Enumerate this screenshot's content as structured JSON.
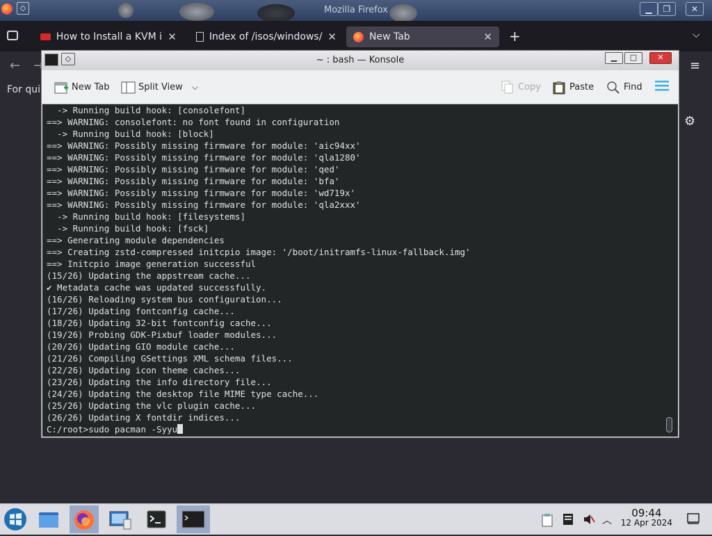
{
  "firefox": {
    "window_title": "Mozilla Firefox",
    "tabs": [
      {
        "label": "How to Install a KVM in A",
        "active": false
      },
      {
        "label": "Index of /isos/windows/",
        "active": false
      },
      {
        "label": "New Tab",
        "active": true
      }
    ],
    "quick_text": "For qui"
  },
  "konsole": {
    "title": "~ : bash — Konsole",
    "toolbar": {
      "new_tab": "New Tab",
      "split_view": "Split View",
      "copy": "Copy",
      "paste": "Paste",
      "find": "Find"
    },
    "lines": [
      "  -> Running build hook: [consolefont]",
      "==> WARNING: consolefont: no font found in configuration",
      "  -> Running build hook: [block]",
      "==> WARNING: Possibly missing firmware for module: 'aic94xx'",
      "==> WARNING: Possibly missing firmware for module: 'qla1280'",
      "==> WARNING: Possibly missing firmware for module: 'qed'",
      "==> WARNING: Possibly missing firmware for module: 'bfa'",
      "==> WARNING: Possibly missing firmware for module: 'wd719x'",
      "==> WARNING: Possibly missing firmware for module: 'qla2xxx'",
      "  -> Running build hook: [filesystems]",
      "  -> Running build hook: [fsck]",
      "==> Generating module dependencies",
      "==> Creating zstd-compressed initcpio image: '/boot/initramfs-linux-fallback.img'",
      "==> Initcpio image generation successful",
      "(15/26) Updating the appstream cache...",
      "✔ Metadata cache was updated successfully.",
      "(16/26) Reloading system bus configuration...",
      "(17/26) Updating fontconfig cache...",
      "(18/26) Updating 32-bit fontconfig cache...",
      "(19/26) Probing GDK-Pixbuf loader modules...",
      "(20/26) Updating GIO module cache...",
      "(21/26) Compiling GSettings XML schema files...",
      "(22/26) Updating icon theme caches...",
      "(23/26) Updating the info directory file...",
      "(24/26) Updating the desktop file MIME type cache...",
      "(25/26) Updating the vlc plugin cache...",
      "(26/26) Updating X fontdir indices..."
    ],
    "prompt": "C:/root>",
    "command": "sudo pacman -Syyu"
  },
  "taskbar": {
    "time": "09:44",
    "date": "12 Apr 2024"
  },
  "colors": {
    "terminal_bg": "#232627",
    "terminal_fg": "#dfe2e4",
    "konsole_toolbar": "#eff0f1",
    "taskbar_bg": "#dbdde2",
    "accent": "#3daee9"
  }
}
